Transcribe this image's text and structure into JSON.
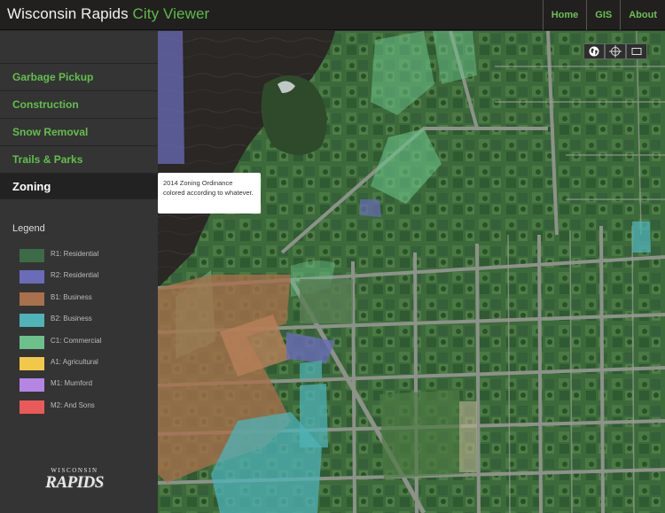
{
  "header": {
    "title_main": "Wisconsin Rapids",
    "title_accent": "City Viewer",
    "nav": [
      "Home",
      "GIS",
      "About"
    ]
  },
  "sidebar": {
    "menu": [
      {
        "label": "Garbage Pickup"
      },
      {
        "label": "Construction"
      },
      {
        "label": "Snow Removal"
      },
      {
        "label": "Trails & Parks"
      },
      {
        "label": "Zoning"
      }
    ],
    "active_item": "Zoning",
    "tooltip": "2014 Zoning Ordinance colored according to whatever.",
    "legend_title": "Legend",
    "legend": [
      {
        "label": "R1: Residential",
        "color": "#3d6b45"
      },
      {
        "label": "R2: Residential",
        "color": "#6a6cb8"
      },
      {
        "label": "B1: Business",
        "color": "#a8704c"
      },
      {
        "label": "B2: Business",
        "color": "#4fb3b8"
      },
      {
        "label": "C1:  Commercial",
        "color": "#6bc189"
      },
      {
        "label": "A1: Agricultural",
        "color": "#f2c84b"
      },
      {
        "label": "M1: Mumford",
        "color": "#b585e4"
      },
      {
        "label": "M2: And Sons",
        "color": "#ea5a5a"
      }
    ],
    "logo_top": "WISCONSIN",
    "logo_main": "RAPIDS"
  },
  "map": {
    "controls": [
      {
        "icon": "globe-icon"
      },
      {
        "icon": "crosshair-icon"
      },
      {
        "icon": "fullscreen-icon"
      }
    ]
  }
}
